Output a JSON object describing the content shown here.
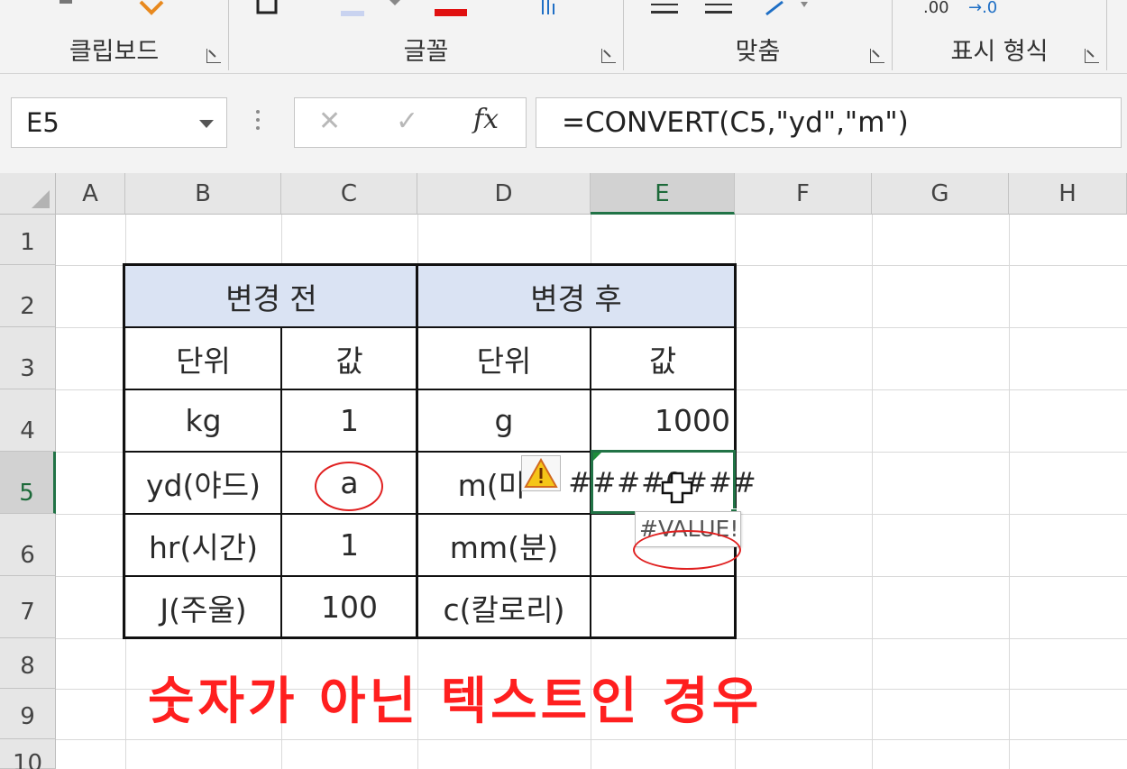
{
  "ribbon": {
    "groups": [
      {
        "name": "클립보드"
      },
      {
        "name": "글꼴"
      },
      {
        "name": "맞춤"
      },
      {
        "name": "표시 형식"
      }
    ],
    "number_format_glyphs": {
      "decimal_a": ".00",
      "decimal_b": "→.0"
    }
  },
  "formula_bar": {
    "name_box": "E5",
    "cancel_glyph": "✕",
    "enter_glyph": "✓",
    "fx_label": "fx",
    "formula": "=CONVERT(C5,\"yd\",\"m\")"
  },
  "columns": [
    "A",
    "B",
    "C",
    "D",
    "E",
    "F",
    "G",
    "H"
  ],
  "rows": [
    "1",
    "2",
    "3",
    "4",
    "5",
    "6",
    "7",
    "8",
    "9",
    "10"
  ],
  "selection": {
    "column": "E",
    "row": "5"
  },
  "table": {
    "header_before": "변경 전",
    "header_after": "변경 후",
    "subheaders": {
      "unit_before": "단위",
      "value_before": "값",
      "unit_after": "단위",
      "value_after": "값"
    },
    "rows": [
      {
        "unit_before": "kg",
        "value_before": "1",
        "unit_after": "g",
        "value_after": "1000"
      },
      {
        "unit_before": "yd(야드)",
        "value_before": "a",
        "unit_after": "m(미",
        "value_after": "####0###"
      },
      {
        "unit_before": "hr(시간)",
        "value_before": "1",
        "unit_after": "mm(분)",
        "value_after": ""
      },
      {
        "unit_before": "J(주울)",
        "value_before": "100",
        "unit_after": "c(칼로리)",
        "value_after": ""
      }
    ]
  },
  "error_tooltip": "#VALUE!",
  "caption": "숫자가 아닌 텍스트인 경우",
  "colors": {
    "accent_green": "#217346",
    "header_fill": "#dae3f3",
    "annotation_red": "#e02020"
  }
}
